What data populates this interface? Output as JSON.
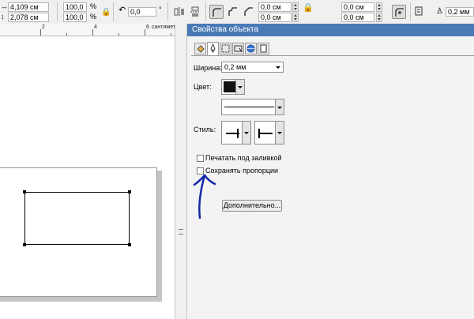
{
  "propbar": {
    "pos_x": "4,109 см",
    "pos_y": "2,078 см",
    "scale_x": "100,0",
    "scale_y": "100,0",
    "percent": "%",
    "rotation": "0,0",
    "degree": "°",
    "corner_1": "0,0 см",
    "corner_2": "0,0 см",
    "corner_3": "0,0 см",
    "corner_4": "0,0 см",
    "outline_width": "0,2 мм"
  },
  "ruler": {
    "marks": [
      "2",
      "4",
      "6"
    ],
    "unit": "сантиметры"
  },
  "docker": {
    "title": "Свойства объекта",
    "tabs": [
      "fill-tab",
      "outline-tab",
      "general-tab",
      "rectangle-tab",
      "internet-tab",
      "summary-tab"
    ],
    "width_label": "Ширина:",
    "width_value": "0,2 мм",
    "color_label": "Цвет:",
    "color_value": "#111111",
    "style_label": "Стиль:",
    "print_behind_fill": "Печатать под заливкой",
    "keep_proportions": "Сохранять пропорции",
    "advanced_button": "Дополнительно..."
  },
  "annotation": {
    "color": "#1428a8"
  }
}
